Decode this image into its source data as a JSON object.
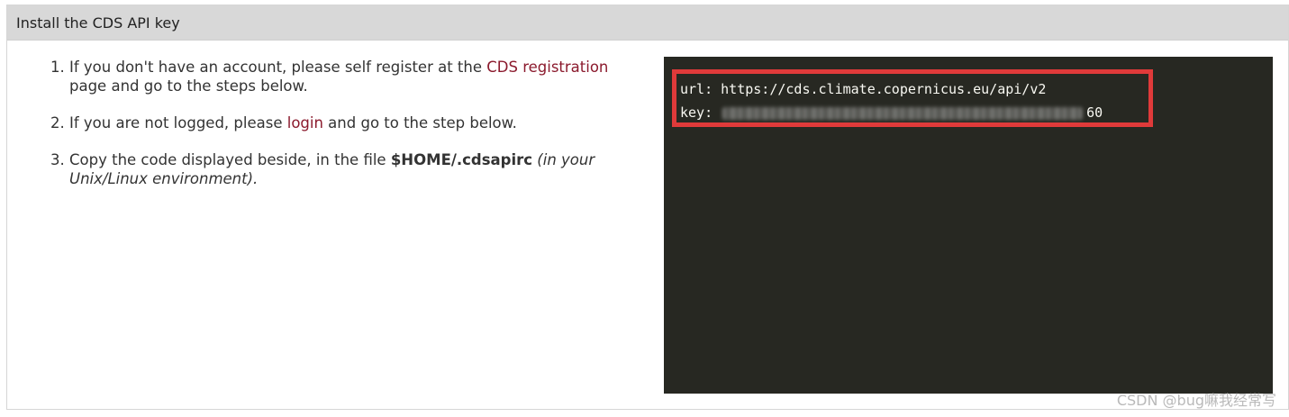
{
  "panel": {
    "title": "Install the CDS API key"
  },
  "steps": [
    {
      "num": "1.",
      "text_before": "If you don't have an account, please self register at the ",
      "link": "CDS registration",
      "text_after": " page and go to the steps below."
    },
    {
      "num": "2.",
      "text_before": "If you are not logged, please ",
      "link": "login",
      "text_after": " and go to the step below."
    },
    {
      "num": "3.",
      "text_before": "Copy the code displayed beside, in the file ",
      "bold": "$HOME/.cdsapirc",
      "italic": " (in your Unix/Linux environment)."
    }
  ],
  "code": {
    "url_line": "url: https://cds.climate.copernicus.eu/api/v2",
    "key_prefix": "key: ",
    "key_visible_suffix": "60"
  },
  "colors": {
    "header_bg": "#d8d8d8",
    "link": "#8b1a2d",
    "terminal_bg": "#272822",
    "highlight_border": "#e03a3a"
  },
  "watermark": "CSDN @bug嘛我经常写"
}
